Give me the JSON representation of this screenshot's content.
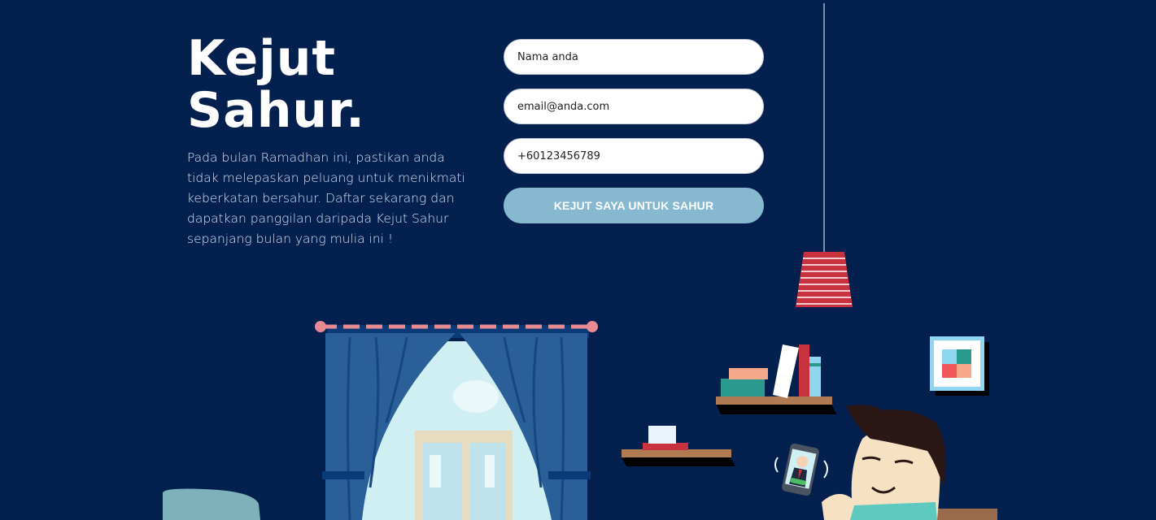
{
  "hero": {
    "title": "Kejut\nSahur.",
    "description": "Pada bulan Ramadhan ini, pastikan anda tidak melepaskan peluang untuk menikmati keberkatan bersahur. Daftar sekarang dan dapatkan panggilan daripada Kejut Sahur sepanjang bulan yang mulia ini !"
  },
  "form": {
    "name_placeholder": "Nama anda",
    "email_placeholder": "email@anda.com",
    "phone_placeholder": "+60123456789",
    "submit_label": "KEJUT SAYA UNTUK SAHUR"
  },
  "colors": {
    "background": "#03204f",
    "button": "#86b9d0",
    "curtain": "#2a5f98",
    "lamp": "#c8323f"
  }
}
